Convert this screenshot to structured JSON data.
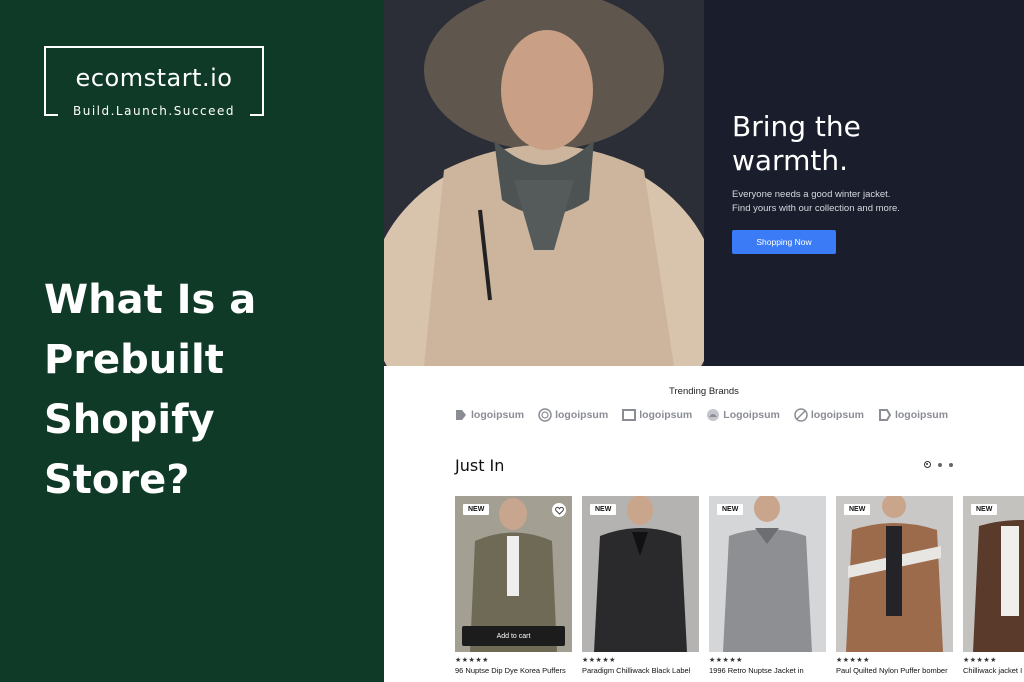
{
  "brand": {
    "name": "ecomstart.io",
    "tagline": "Build.Launch.Succeed"
  },
  "headline": [
    "What Is a",
    "Prebuilt",
    "Shopify",
    "Store?"
  ],
  "hero": {
    "title_line1": "Bring the",
    "title_line2": "warmth.",
    "description": "Everyone needs a good winter jacket.\nFind yours with our collection and more.",
    "button_label": "Shopping Now"
  },
  "trending": {
    "title": "Trending Brands",
    "brands": [
      "logoipsum",
      "logoipsum",
      "logoipsum",
      "Logoipsum",
      "logoipsum",
      "logoipsum"
    ]
  },
  "just_in": {
    "title": "Just In"
  },
  "products": [
    {
      "badge": "NEW",
      "rating": "★★★★★",
      "name": "96 Nuptse Dip Dye Korea Puffers",
      "color": "#6e6a55",
      "add_to_cart": "Add to cart"
    },
    {
      "badge": "NEW",
      "rating": "★★★★★",
      "name": "Paradigm Chilliwack Black Label",
      "color": "#2a2a2c"
    },
    {
      "badge": "NEW",
      "rating": "★★★★★",
      "name": "1996 Retro Nuptse Jacket in",
      "color": "#8d8f92"
    },
    {
      "badge": "NEW",
      "rating": "★★★★★",
      "name": "Paul Quilted Nylon Puffer bomber",
      "color": "#9b6b4c"
    },
    {
      "badge": "NEW",
      "rating": "★★★★★",
      "name": "Chilliwack jacket I",
      "color": "#5a3a2b"
    }
  ],
  "colors": {
    "left_bg": "#0f3a28",
    "hero_bg": "#1a1d2b",
    "cta": "#3b7bf6"
  }
}
